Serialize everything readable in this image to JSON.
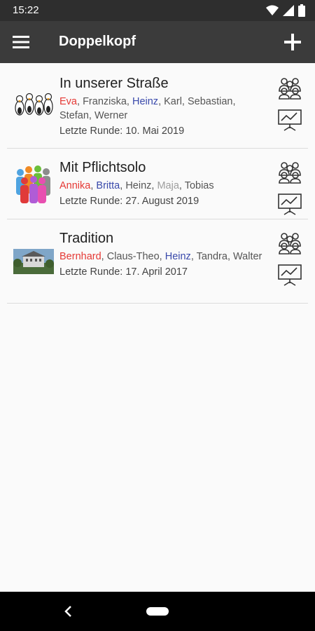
{
  "statusbar": {
    "time": "15:22"
  },
  "appbar": {
    "title": "Doppelkopf"
  },
  "groups": [
    {
      "title": "In unserer Straße",
      "players": [
        "Eva",
        "Franziska",
        "Heinz",
        "Karl",
        "Sebastian",
        "Stefan",
        "Werner"
      ],
      "last_round": "Letzte Runde: 10. Mai 2019"
    },
    {
      "title": "Mit Pflichtsolo",
      "players": [
        "Annika",
        "Britta",
        "Heinz",
        "Maja",
        "Tobias"
      ],
      "last_round": "Letzte Runde: 27. August 2019"
    },
    {
      "title": "Tradition",
      "players": [
        "Bernhard",
        "Claus-Theo",
        "Heinz",
        "Tandra",
        "Walter"
      ],
      "last_round": "Letzte Runde: 17. April 2017"
    }
  ],
  "colors": {
    "red": "#e53935",
    "blue": "#3949ab",
    "grey": "#9e9e9e",
    "appbar": "#3b3b3b"
  },
  "icons": [
    "menu-icon",
    "add-icon",
    "group-icon",
    "statistics-icon",
    "back-icon"
  ]
}
